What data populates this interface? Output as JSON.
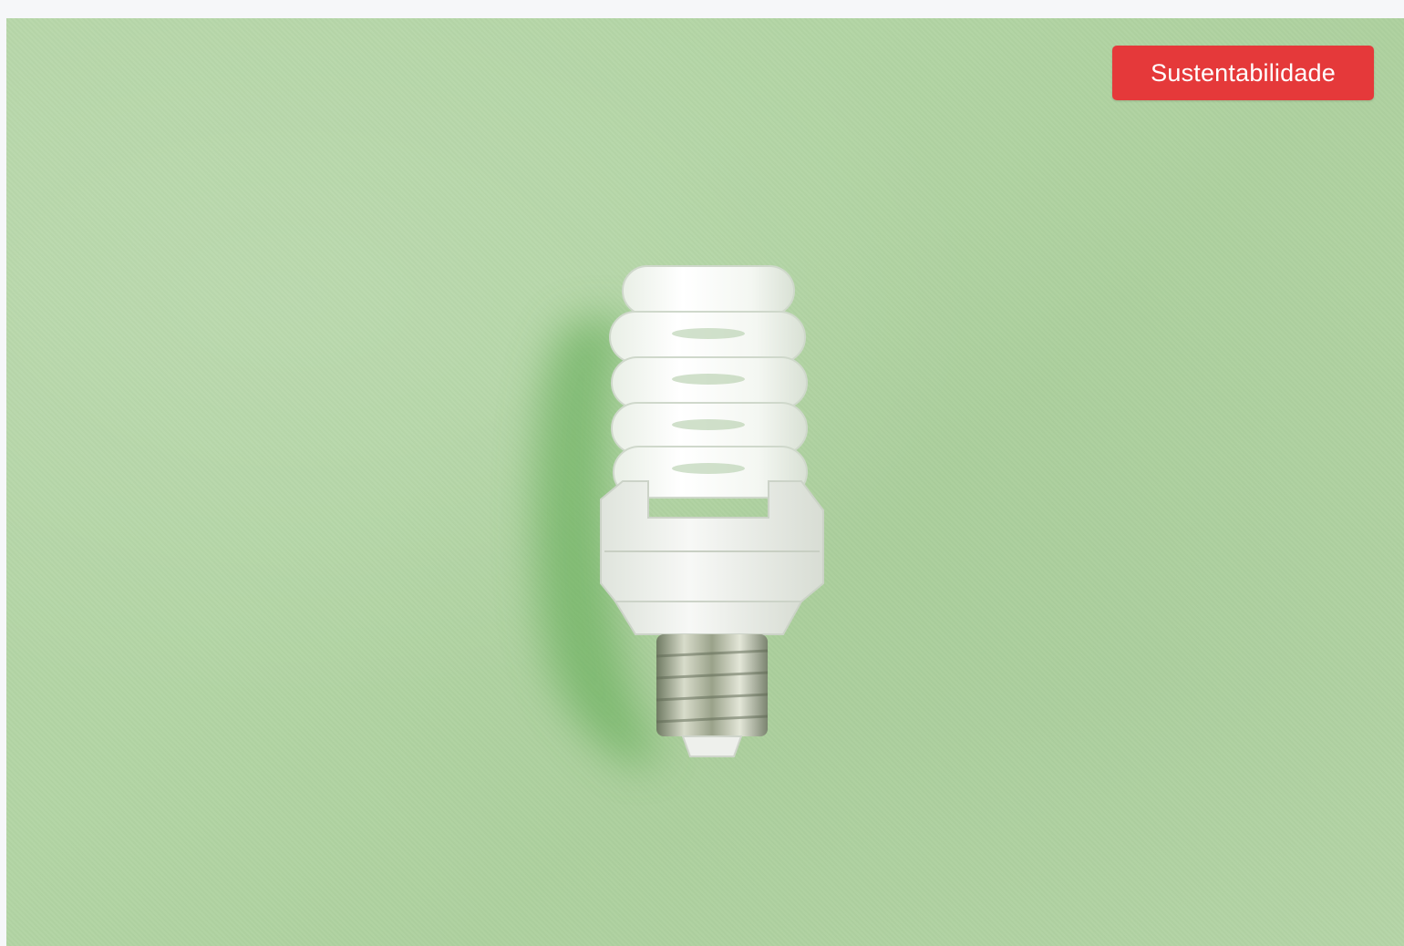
{
  "badge": {
    "label": "Sustentabilidade",
    "color": "#e5393a"
  },
  "image": {
    "subject": "cfl-bulb-icon",
    "background_color": "#b3d5a5"
  }
}
